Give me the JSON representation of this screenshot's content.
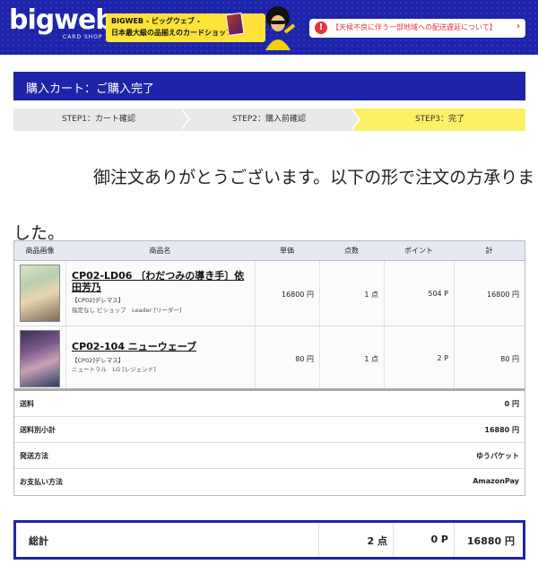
{
  "header": {
    "logo": "bigweb",
    "logo_sub": "CARD SHOP",
    "promo_line1": "BIGWEB - ビッグウェブ -",
    "promo_line2": "日本最大級の品揃えのカードショップ！",
    "notice": "【天候不良に伴う一部地域への配送遅延について】"
  },
  "page_title": "購入カート：ご購入完了",
  "steps": [
    {
      "label": "STEP1：カート確認",
      "active": false
    },
    {
      "label": "STEP2：購入前確認",
      "active": false
    },
    {
      "label": "STEP3：完了",
      "active": true
    }
  ],
  "thanks": {
    "line1": "御注文ありがとうございます。以下の形で注文の方承りま",
    "line2": "した。"
  },
  "table": {
    "headers": [
      "商品画像",
      "商品名",
      "単価",
      "点数",
      "ポイント",
      "計"
    ],
    "items": [
      {
        "name": "CP02-LD06 〔わだつみの導き手〕依田芳乃",
        "tag": "【CP02]デレマス】",
        "desc": "指定なし ビショップ　Leader [リーダー]",
        "price": "16800 円",
        "qty": "1 点",
        "points": "504 P",
        "total": "16800 円"
      },
      {
        "name": "CP02-104 ニューウェーブ",
        "tag": "【CP02]デレマス】",
        "desc": "ニュートラル　LG [レジェンド]",
        "price": "80 円",
        "qty": "1 点",
        "points": "2 P",
        "total": "80 円"
      }
    ],
    "summary": [
      {
        "label": "送料",
        "value": "0 円"
      },
      {
        "label": "送料別小計",
        "value": "16880 円"
      },
      {
        "label": "発送方法",
        "value": "ゆうパケット"
      },
      {
        "label": "お支払い方法",
        "value": "AmazonPay"
      }
    ]
  },
  "total": {
    "label": "総計",
    "qty": "2 点",
    "points": "0 P",
    "price": "16880 円"
  },
  "colors": {
    "brand_blue": "#1e24a8",
    "active_step": "#fbf066",
    "notice_red": "#e8323c"
  }
}
